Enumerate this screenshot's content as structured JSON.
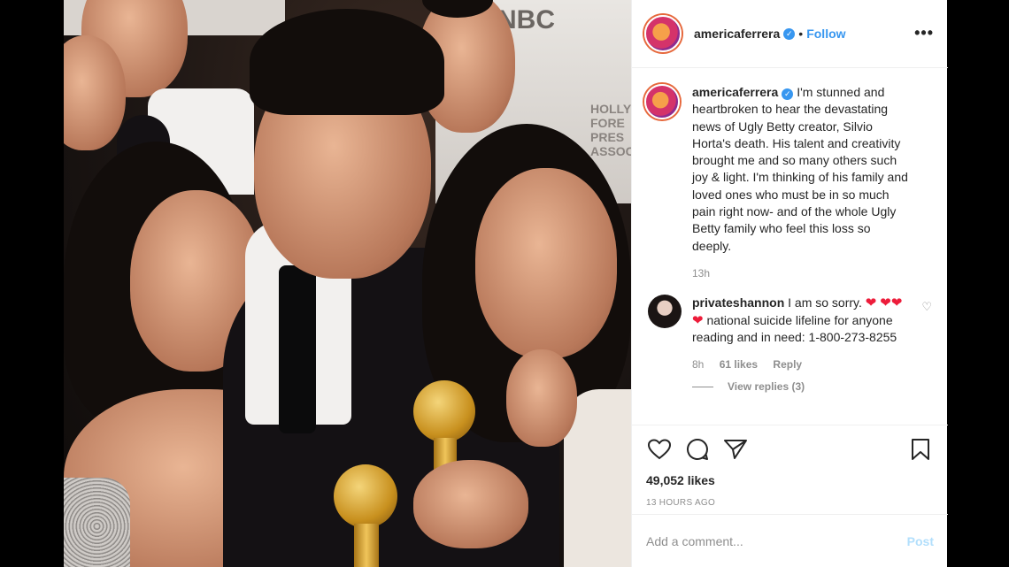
{
  "header": {
    "username": "americaferrera",
    "verified_icon": "verified-badge-icon",
    "separator": "•",
    "follow_label": "Follow",
    "more_label": "•••"
  },
  "caption": {
    "username": "americaferrera",
    "text": "I'm stunned and heartbroken to hear the devastating news of Ugly Betty creator, Silvio Horta's death. His talent and creativity brought me and so many others such joy & light. I'm thinking of his family and loved ones who must be in so much pain right now- and of the whole Ugly Betty family who feel this loss so deeply.",
    "time": "13h"
  },
  "comment": {
    "username": "privateshannon",
    "text_before": "I am so sorry.",
    "hearts_inline": "❤",
    "hearts_line": "❤❤❤",
    "text_after": "national suicide lifeline for anyone reading and in need: 1-800-273-8255",
    "time": "8h",
    "likes": "61 likes",
    "reply_label": "Reply",
    "view_replies": "View replies (3)"
  },
  "actions": {
    "likes": "49,052 likes",
    "timestamp": "13 HOURS AGO"
  },
  "add_comment": {
    "placeholder": "Add a comment...",
    "post_label": "Post"
  },
  "photo": {
    "brand_nbc": "NBC",
    "brand_hfpa": "HOLLY\nFORE\nPRES\nASSOC"
  },
  "colors": {
    "link": "#3897f0",
    "muted": "#8e8e8e",
    "text": "#262626",
    "post_disabled": "#b2dffc",
    "heart": "#ed1c3a"
  }
}
